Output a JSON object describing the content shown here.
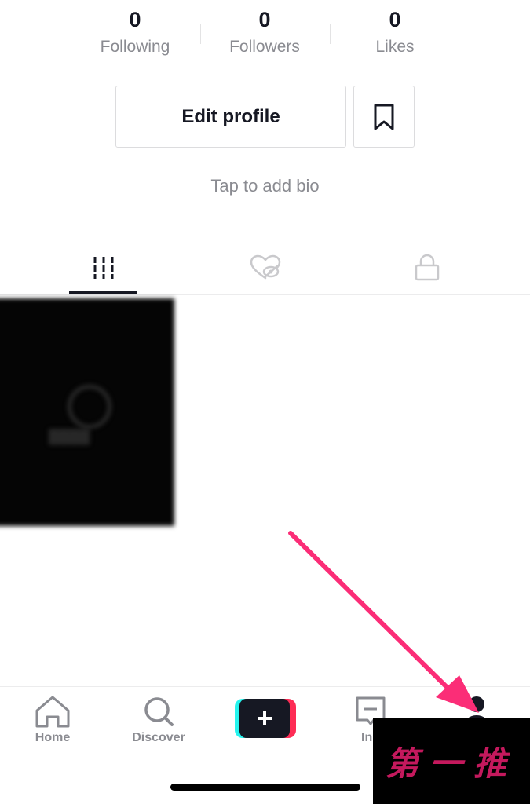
{
  "stats": [
    {
      "value": "0",
      "label": "Following"
    },
    {
      "value": "0",
      "label": "Followers"
    },
    {
      "value": "0",
      "label": "Likes"
    }
  ],
  "profile": {
    "edit_label": "Edit profile",
    "bio_placeholder": "Tap to add bio"
  },
  "tabs": [
    {
      "icon": "videos-grid-icon",
      "active": true
    },
    {
      "icon": "liked-hidden-icon",
      "active": false
    },
    {
      "icon": "lock-icon",
      "active": false
    }
  ],
  "nav": {
    "home_label": "Home",
    "discover_label": "Discover",
    "inbox_label": "Inb"
  },
  "watermark": {
    "text": "第一推"
  },
  "colors": {
    "text_primary": "#161823",
    "text_secondary": "#8a8b91",
    "annotation_arrow": "#fb2d77",
    "create_cyan": "#25f4ee",
    "create_pink": "#fe2c55"
  }
}
